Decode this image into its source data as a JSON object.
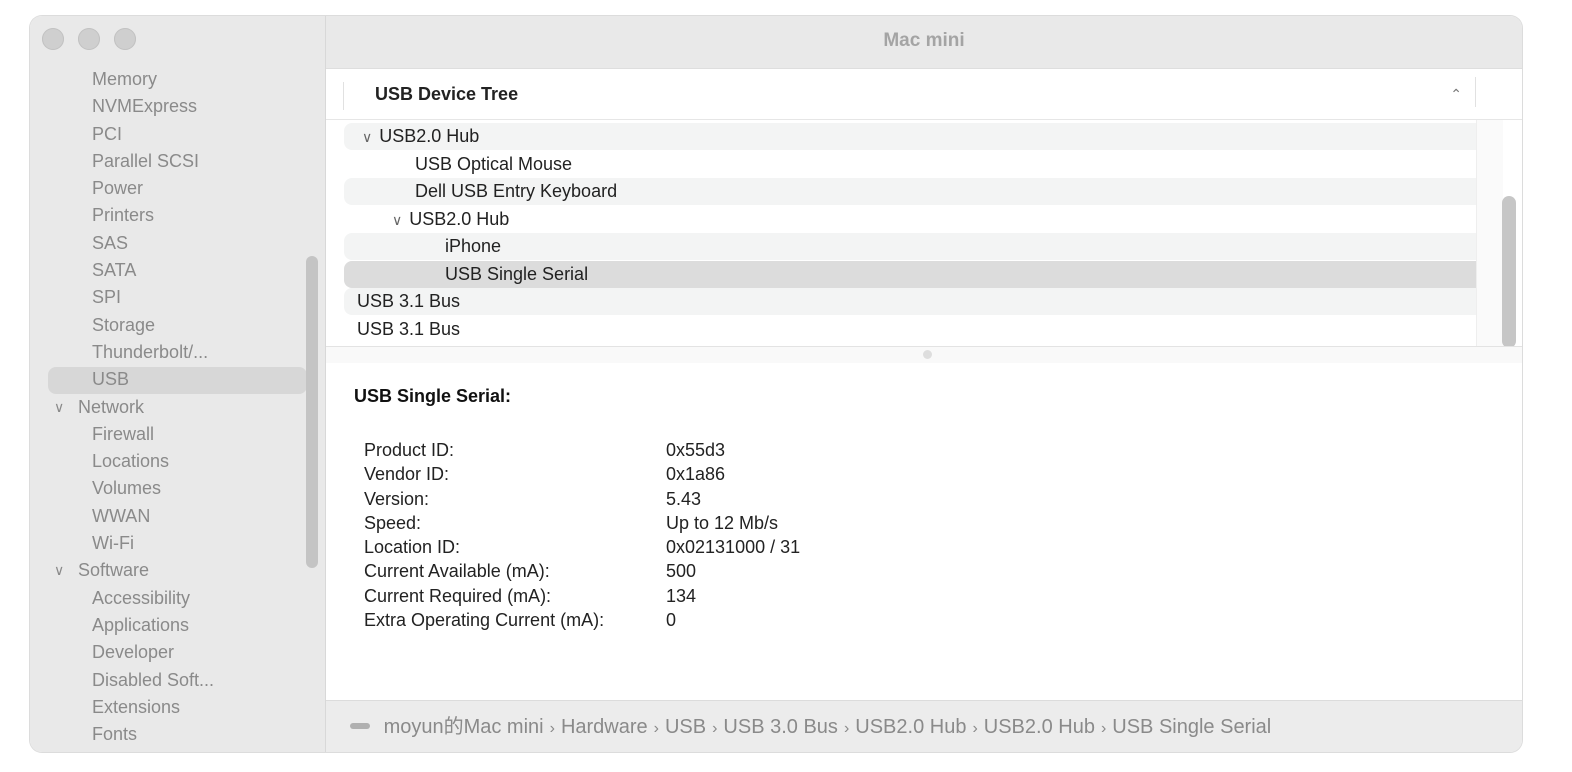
{
  "window": {
    "title": "Mac mini",
    "traffic_lights": [
      "close",
      "minimize",
      "zoom"
    ]
  },
  "sidebar": {
    "items": [
      {
        "label": "Memory",
        "type": "child"
      },
      {
        "label": "NVMExpress",
        "type": "child"
      },
      {
        "label": "PCI",
        "type": "child"
      },
      {
        "label": "Parallel SCSI",
        "type": "child"
      },
      {
        "label": "Power",
        "type": "child"
      },
      {
        "label": "Printers",
        "type": "child"
      },
      {
        "label": "SAS",
        "type": "child"
      },
      {
        "label": "SATA",
        "type": "child"
      },
      {
        "label": "SPI",
        "type": "child"
      },
      {
        "label": "Storage",
        "type": "child"
      },
      {
        "label": "Thunderbolt/...",
        "type": "child"
      },
      {
        "label": "USB",
        "type": "child",
        "selected": true
      },
      {
        "label": "Network",
        "type": "group",
        "expanded": true
      },
      {
        "label": "Firewall",
        "type": "child"
      },
      {
        "label": "Locations",
        "type": "child"
      },
      {
        "label": "Volumes",
        "type": "child"
      },
      {
        "label": "WWAN",
        "type": "child"
      },
      {
        "label": "Wi-Fi",
        "type": "child"
      },
      {
        "label": "Software",
        "type": "group",
        "expanded": true
      },
      {
        "label": "Accessibility",
        "type": "child"
      },
      {
        "label": "Applications",
        "type": "child"
      },
      {
        "label": "Developer",
        "type": "child"
      },
      {
        "label": "Disabled Soft...",
        "type": "child"
      },
      {
        "label": "Extensions",
        "type": "child"
      },
      {
        "label": "Fonts",
        "type": "child"
      }
    ]
  },
  "tree": {
    "header": "USB Device Tree",
    "sort_icon": "chevron-up-icon",
    "rows": [
      {
        "label": "USB2.0 Hub",
        "level": 1,
        "expanded": true
      },
      {
        "label": "USB Optical Mouse",
        "level": 2
      },
      {
        "label": "Dell USB Entry Keyboard",
        "level": 2
      },
      {
        "label": "USB2.0 Hub",
        "level": 2,
        "expanded": true
      },
      {
        "label": "iPhone",
        "level": 3
      },
      {
        "label": "USB Single Serial",
        "level": 3,
        "selected": true
      },
      {
        "label": "USB 3.1 Bus",
        "level": 0
      },
      {
        "label": "USB 3.1 Bus",
        "level": 0
      }
    ]
  },
  "detail": {
    "title": "USB Single Serial:",
    "properties": [
      {
        "key": "Product ID:",
        "value": "0x55d3"
      },
      {
        "key": "Vendor ID:",
        "value": "0x1a86"
      },
      {
        "key": "Version:",
        "value": "5.43"
      },
      {
        "key": "Speed:",
        "value": "Up to 12 Mb/s"
      },
      {
        "key": "Location ID:",
        "value": "0x02131000 / 31"
      },
      {
        "key": "Current Available (mA):",
        "value": "500"
      },
      {
        "key": "Current Required (mA):",
        "value": "134"
      },
      {
        "key": "Extra Operating Current (mA):",
        "value": "0"
      }
    ]
  },
  "breadcrumb": {
    "icon": "mac-mini-icon",
    "separator": "›",
    "items": [
      "moyun的Mac mini",
      "Hardware",
      "USB",
      "USB 3.0 Bus",
      "USB2.0 Hub",
      "USB2.0 Hub",
      "USB Single Serial"
    ]
  }
}
